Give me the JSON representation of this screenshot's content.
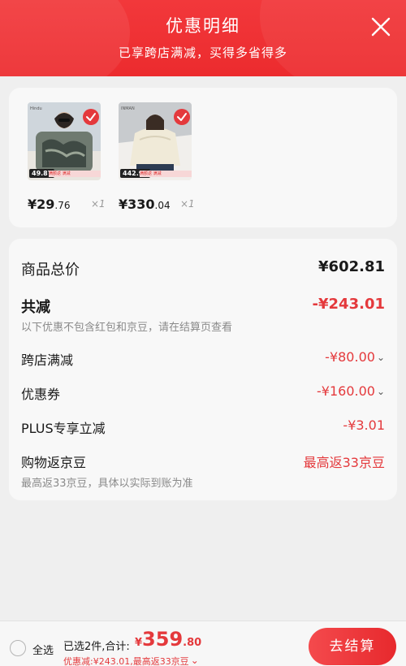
{
  "header": {
    "title": "优惠明细",
    "subtitle": "已享跨店满减，买得多省得多"
  },
  "products": [
    {
      "price_int": "¥29",
      "price_dec": ".76",
      "qty": "×1",
      "tag": "49.87",
      "strip": "满额返 满减"
    },
    {
      "price_int": "¥330",
      "price_dec": ".04",
      "qty": "×1",
      "tag": "442.94",
      "strip": "满额返 满减"
    }
  ],
  "summary": {
    "total_label": "商品总价",
    "total_value": "¥602.81",
    "reduce_label": "共减",
    "reduce_value": "-¥243.01",
    "reduce_note": "以下优惠不包含红包和京豆，请在结算页查看",
    "cross_store_label": "跨店满减",
    "cross_store_value": "-¥80.00",
    "coupon_label": "优惠券",
    "coupon_value": "-¥160.00",
    "plus_label": "PLUS专享立减",
    "plus_value": "-¥3.01",
    "jd_bean_label": "购物返京豆",
    "jd_bean_value": "最高返33京豆",
    "jd_bean_note": "最高返33京豆，具体以实际到账为准"
  },
  "footer": {
    "select_all": "全选",
    "selected_text": "已选2件,合计:",
    "total_yen": "¥",
    "total_int": "359",
    "total_dec": ".80",
    "detail": "优惠减:¥243.01,最高返33京豆",
    "checkout": "去结算"
  },
  "colors": {
    "header_red": "#ec2b2e",
    "accent_red": "#e4393c"
  }
}
